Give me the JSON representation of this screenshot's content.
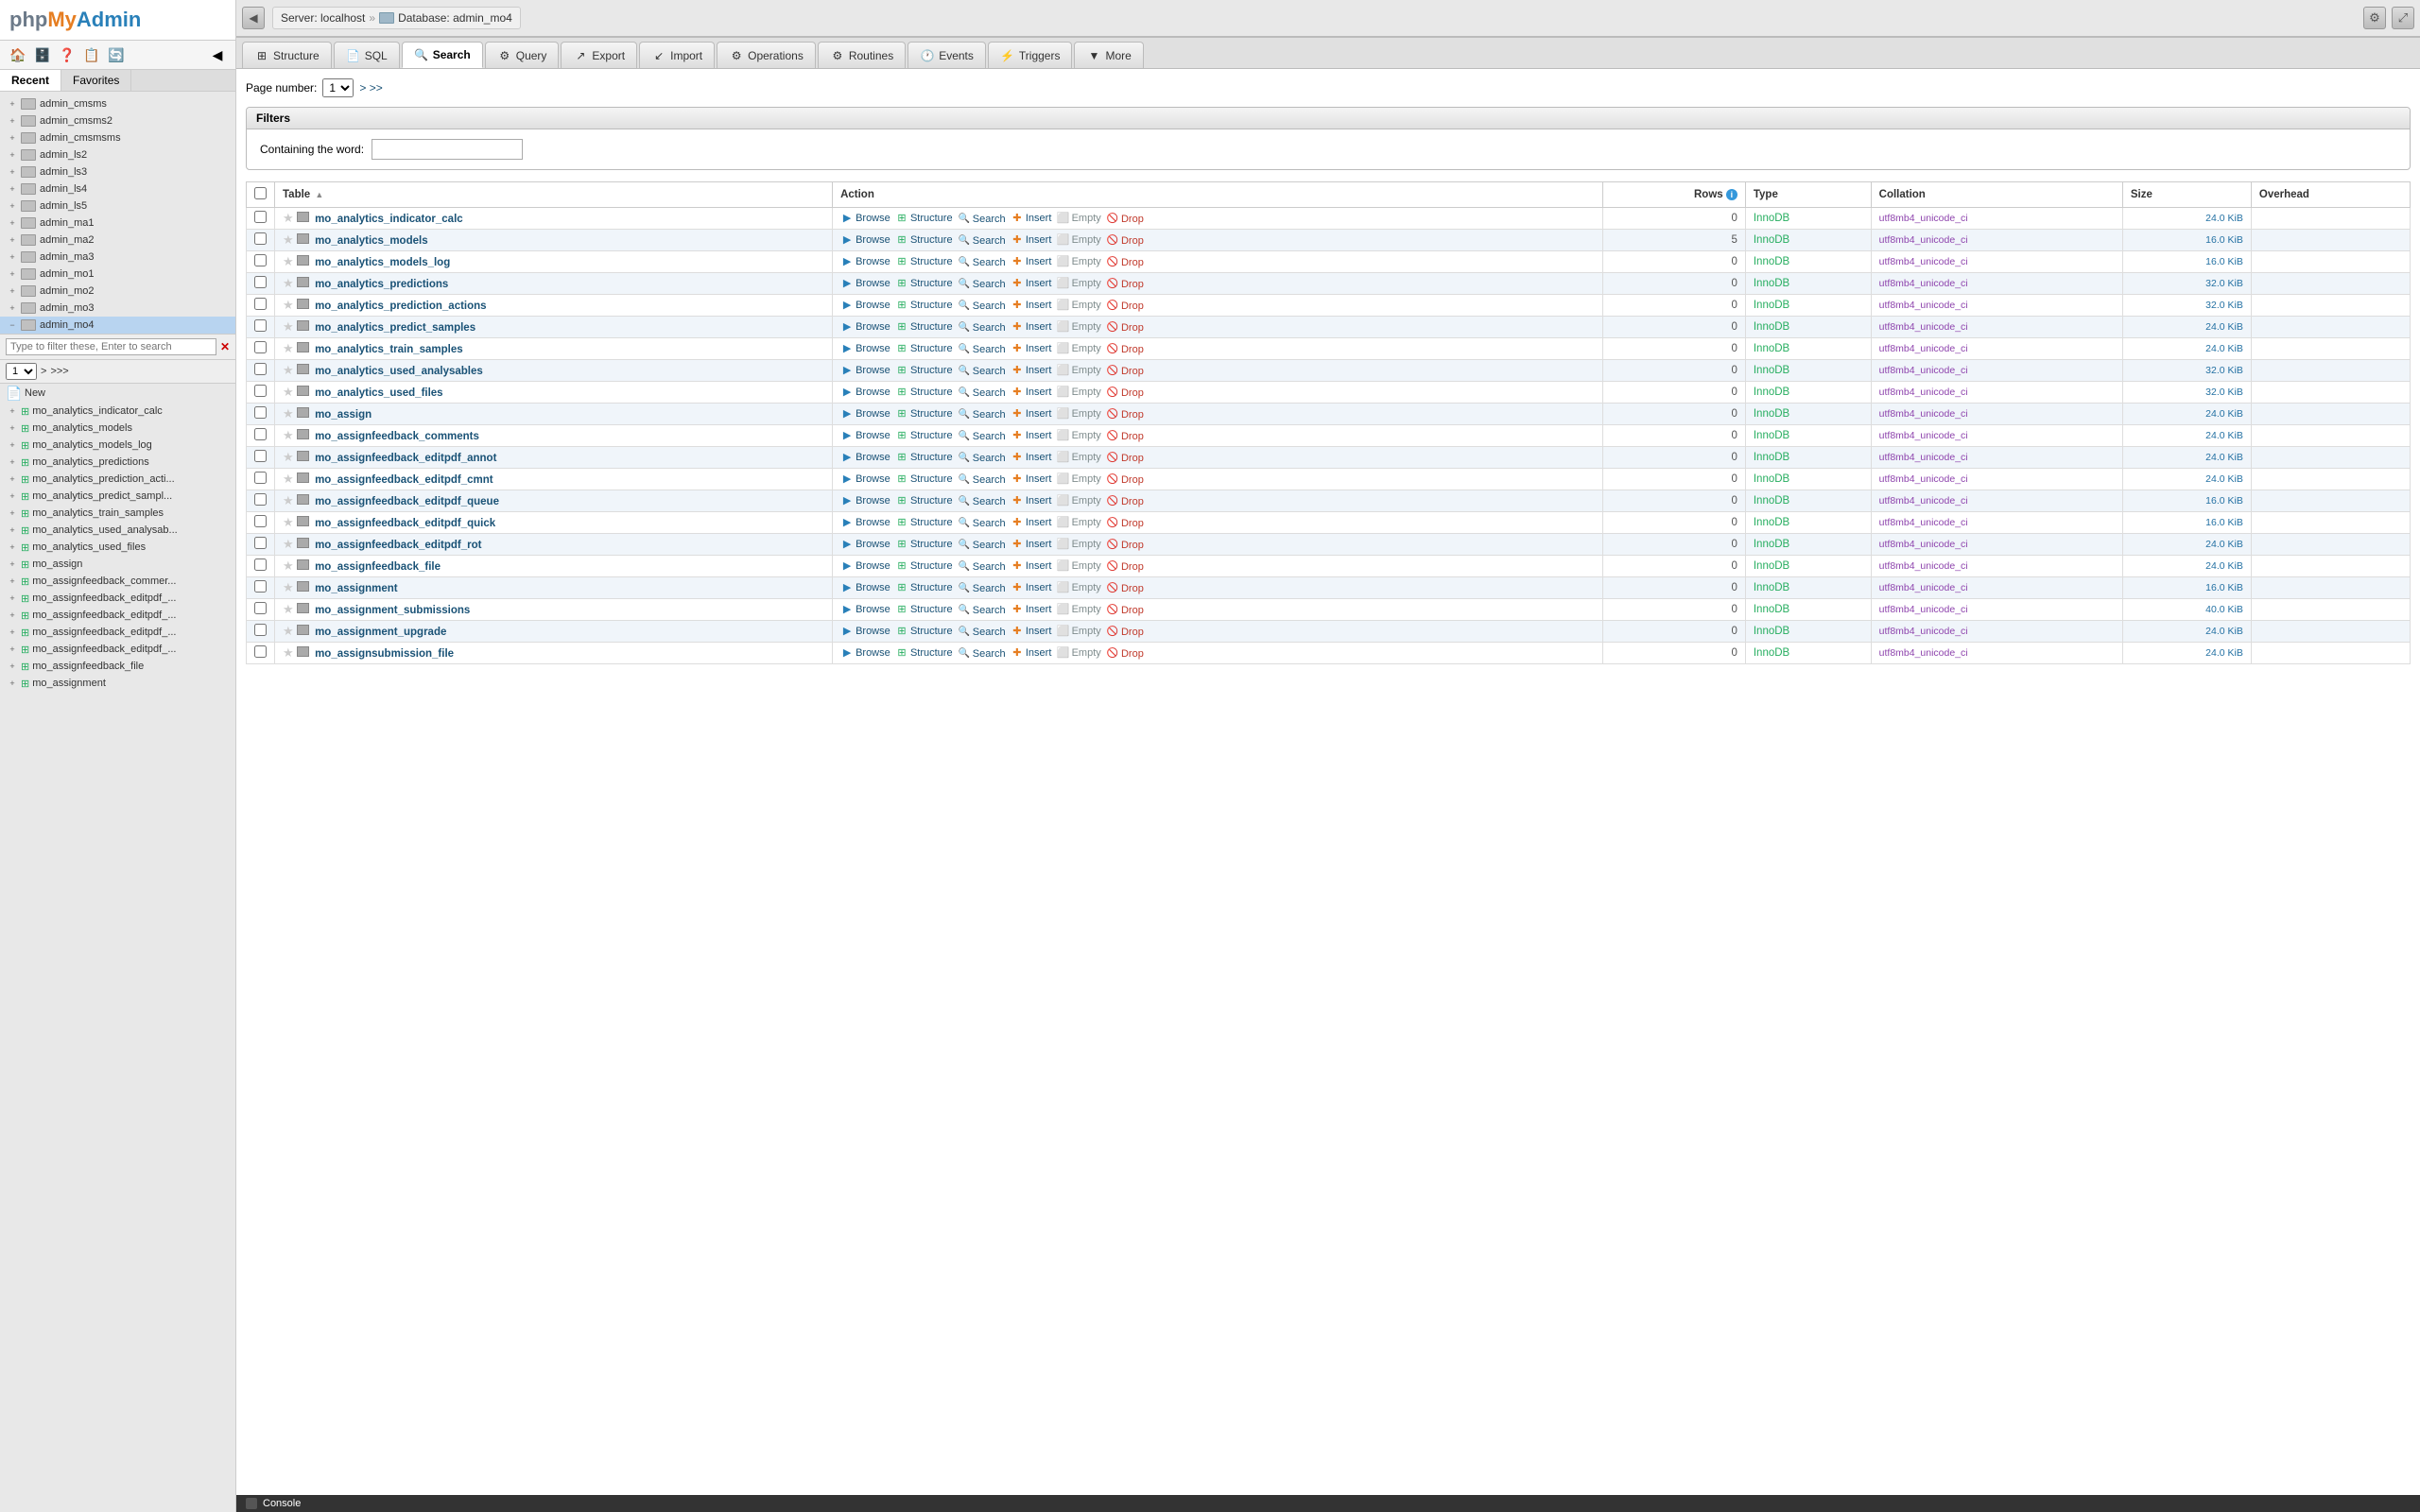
{
  "sidebar": {
    "logo": {
      "php": "php",
      "my": "My",
      "admin": "Admin"
    },
    "tabs": [
      {
        "label": "Recent",
        "active": true
      },
      {
        "label": "Favorites",
        "active": false
      }
    ],
    "databases": [
      {
        "name": "admin_cmsms",
        "expanded": false
      },
      {
        "name": "admin_cmsms2",
        "expanded": false
      },
      {
        "name": "admin_cmsmsms",
        "expanded": false
      },
      {
        "name": "admin_ls2",
        "expanded": false
      },
      {
        "name": "admin_ls3",
        "expanded": false
      },
      {
        "name": "admin_ls4",
        "expanded": false
      },
      {
        "name": "admin_ls5",
        "expanded": false
      },
      {
        "name": "admin_ma1",
        "expanded": false
      },
      {
        "name": "admin_ma2",
        "expanded": false
      },
      {
        "name": "admin_ma3",
        "expanded": false
      },
      {
        "name": "admin_mo1",
        "expanded": false
      },
      {
        "name": "admin_mo2",
        "expanded": false
      },
      {
        "name": "admin_mo3",
        "expanded": false
      },
      {
        "name": "admin_mo4",
        "expanded": true,
        "active": true
      }
    ],
    "filter_placeholder": "Type to filter these, Enter to search",
    "page_num": "1",
    "new_label": "New",
    "tables": [
      "mo_analytics_indicator_calc",
      "mo_analytics_models",
      "mo_analytics_models_log",
      "mo_analytics_predictions",
      "mo_analytics_prediction_acti...",
      "mo_analytics_predict_sampl...",
      "mo_analytics_train_samples",
      "mo_analytics_used_analysab...",
      "mo_analytics_used_files",
      "mo_assign",
      "mo_assignfeedback_commer...",
      "mo_assignfeedback_editpdf_...",
      "mo_assignfeedback_editpdf_...",
      "mo_assignfeedback_editpdf_...",
      "mo_assignfeedback_editpdf_...",
      "mo_assignfeedback_file",
      "mo_assignment"
    ]
  },
  "breadcrumb": {
    "server": "Server: localhost",
    "separator": "»",
    "database_icon": "db",
    "database": "Database: admin_mo4"
  },
  "nav_tabs": [
    {
      "label": "Structure",
      "icon": "⊞",
      "active": false
    },
    {
      "label": "SQL",
      "icon": "📄",
      "active": false
    },
    {
      "label": "Search",
      "icon": "🔍",
      "active": true
    },
    {
      "label": "Query",
      "icon": "⚙",
      "active": false
    },
    {
      "label": "Export",
      "icon": "↗",
      "active": false
    },
    {
      "label": "Import",
      "icon": "↙",
      "active": false
    },
    {
      "label": "Operations",
      "icon": "⚙",
      "active": false
    },
    {
      "label": "Routines",
      "icon": "⚙",
      "active": false
    },
    {
      "label": "Events",
      "icon": "🕐",
      "active": false
    },
    {
      "label": "Triggers",
      "icon": "⚡",
      "active": false
    },
    {
      "label": "More",
      "icon": "▼",
      "active": false
    }
  ],
  "page_number_label": "Page number:",
  "page_number_value": "1",
  "page_nav": ">>>",
  "filters": {
    "title": "Filters",
    "label": "Containing the word:",
    "placeholder": ""
  },
  "table_headers": {
    "table": "Table",
    "action": "Action",
    "rows": "Rows",
    "type": "Type",
    "collation": "Collation",
    "size": "Size",
    "overhead": "Overhead"
  },
  "tables": [
    {
      "name": "mo_analytics_indicator_calc",
      "rows": 0,
      "type": "InnoDB",
      "collation": "utf8mb4_unicode_ci",
      "size": "24.0 KiB",
      "overhead": ""
    },
    {
      "name": "mo_analytics_models",
      "rows": 5,
      "type": "InnoDB",
      "collation": "utf8mb4_unicode_ci",
      "size": "16.0 KiB",
      "overhead": ""
    },
    {
      "name": "mo_analytics_models_log",
      "rows": 0,
      "type": "InnoDB",
      "collation": "utf8mb4_unicode_ci",
      "size": "16.0 KiB",
      "overhead": ""
    },
    {
      "name": "mo_analytics_predictions",
      "rows": 0,
      "type": "InnoDB",
      "collation": "utf8mb4_unicode_ci",
      "size": "32.0 KiB",
      "overhead": ""
    },
    {
      "name": "mo_analytics_prediction_actions",
      "rows": 0,
      "type": "InnoDB",
      "collation": "utf8mb4_unicode_ci",
      "size": "32.0 KiB",
      "overhead": ""
    },
    {
      "name": "mo_analytics_predict_samples",
      "rows": 0,
      "type": "InnoDB",
      "collation": "utf8mb4_unicode_ci",
      "size": "24.0 KiB",
      "overhead": ""
    },
    {
      "name": "mo_analytics_train_samples",
      "rows": 0,
      "type": "InnoDB",
      "collation": "utf8mb4_unicode_ci",
      "size": "24.0 KiB",
      "overhead": ""
    },
    {
      "name": "mo_analytics_used_analysables",
      "rows": 0,
      "type": "InnoDB",
      "collation": "utf8mb4_unicode_ci",
      "size": "32.0 KiB",
      "overhead": ""
    },
    {
      "name": "mo_analytics_used_files",
      "rows": 0,
      "type": "InnoDB",
      "collation": "utf8mb4_unicode_ci",
      "size": "32.0 KiB",
      "overhead": ""
    },
    {
      "name": "mo_assign",
      "rows": 0,
      "type": "InnoDB",
      "collation": "utf8mb4_unicode_ci",
      "size": "24.0 KiB",
      "overhead": ""
    },
    {
      "name": "mo_assignfeedback_comments",
      "rows": 0,
      "type": "InnoDB",
      "collation": "utf8mb4_unicode_ci",
      "size": "24.0 KiB",
      "overhead": ""
    },
    {
      "name": "mo_assignfeedback_editpdf_annot",
      "rows": 0,
      "type": "InnoDB",
      "collation": "utf8mb4_unicode_ci",
      "size": "24.0 KiB",
      "overhead": ""
    },
    {
      "name": "mo_assignfeedback_editpdf_cmnt",
      "rows": 0,
      "type": "InnoDB",
      "collation": "utf8mb4_unicode_ci",
      "size": "24.0 KiB",
      "overhead": ""
    },
    {
      "name": "mo_assignfeedback_editpdf_queue",
      "rows": 0,
      "type": "InnoDB",
      "collation": "utf8mb4_unicode_ci",
      "size": "16.0 KiB",
      "overhead": ""
    },
    {
      "name": "mo_assignfeedback_editpdf_quick",
      "rows": 0,
      "type": "InnoDB",
      "collation": "utf8mb4_unicode_ci",
      "size": "16.0 KiB",
      "overhead": ""
    },
    {
      "name": "mo_assignfeedback_editpdf_rot",
      "rows": 0,
      "type": "InnoDB",
      "collation": "utf8mb4_unicode_ci",
      "size": "24.0 KiB",
      "overhead": ""
    },
    {
      "name": "mo_assignfeedback_file",
      "rows": 0,
      "type": "InnoDB",
      "collation": "utf8mb4_unicode_ci",
      "size": "24.0 KiB",
      "overhead": ""
    },
    {
      "name": "mo_assignment",
      "rows": 0,
      "type": "InnoDB",
      "collation": "utf8mb4_unicode_ci",
      "size": "16.0 KiB",
      "overhead": ""
    },
    {
      "name": "mo_assignment_submissions",
      "rows": 0,
      "type": "InnoDB",
      "collation": "utf8mb4_unicode_ci",
      "size": "40.0 KiB",
      "overhead": ""
    },
    {
      "name": "mo_assignment_upgrade",
      "rows": 0,
      "type": "InnoDB",
      "collation": "utf8mb4_unicode_ci",
      "size": "24.0 KiB",
      "overhead": ""
    },
    {
      "name": "mo_assignsubmission_file",
      "rows": 0,
      "type": "InnoDB",
      "collation": "utf8mb4_unicode_ci",
      "size": "24.0 KiB",
      "overhead": ""
    }
  ],
  "actions": {
    "browse": "Browse",
    "structure": "Structure",
    "search": "Search",
    "insert": "Insert",
    "empty": "Empty",
    "drop": "Drop"
  },
  "console": {
    "label": "Console"
  }
}
